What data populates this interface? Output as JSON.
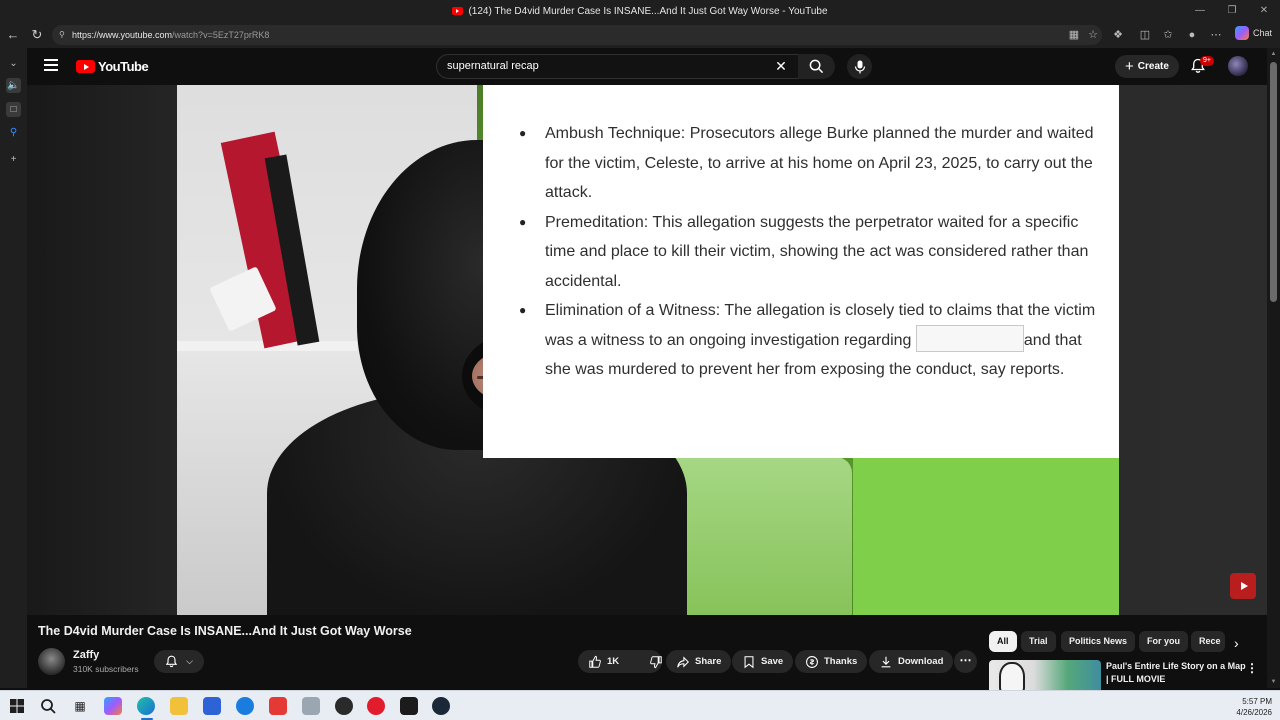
{
  "browser": {
    "tab_title": "(124) The D4vid Murder Case Is INSANE...And It Just Got Way Worse - YouTube",
    "url_host": "https://www.youtube.com",
    "url_path": "/watch?v=5EzT27prRK8",
    "chat_label": "Chat"
  },
  "youtube": {
    "logo_text": "YouTube",
    "search_value": "supernatural recap",
    "create_label": "Create",
    "notification_count": "9+"
  },
  "slide": {
    "bullets": [
      {
        "text": "Ambush Technique: Prosecutors allege Burke planned the murder and waited for the victim, Celeste, to arrive at his home on April 23, 2025, to carry out the attack."
      },
      {
        "text": "Premeditation: This allegation suggests the perpetrator waited for a specific time and place to kill their victim, showing the act was considered rather than accidental."
      },
      {
        "text_before": "Elimination of a Witness: The allegation is closely tied to claims that the victim was a witness to an ongoing investigation regarding",
        "text_after": "and that she was murdered to prevent her from exposing the conduct, say reports."
      }
    ]
  },
  "video": {
    "title": "The D4vid Murder Case Is INSANE...And It Just Got Way Worse",
    "channel_name": "Zaffy",
    "subscribers": "310K subscribers",
    "like_count": "1K",
    "share_label": "Share",
    "save_label": "Save",
    "thanks_label": "Thanks",
    "download_label": "Download"
  },
  "chips": [
    "All",
    "Trial",
    "Politics News",
    "For you",
    "Rece"
  ],
  "suggestion": {
    "title": "Paul's Entire Life Story on a Map | FULL MOVIE"
  },
  "taskbar": {
    "time": "5:57 PM",
    "date": "4/26/2026"
  },
  "colors": {
    "youtube_red": "#ff0000",
    "page_bg": "#0f0f0f",
    "pill_bg": "#272727",
    "slide_bg": "#ffffff",
    "green_screen": "#5ea131"
  }
}
